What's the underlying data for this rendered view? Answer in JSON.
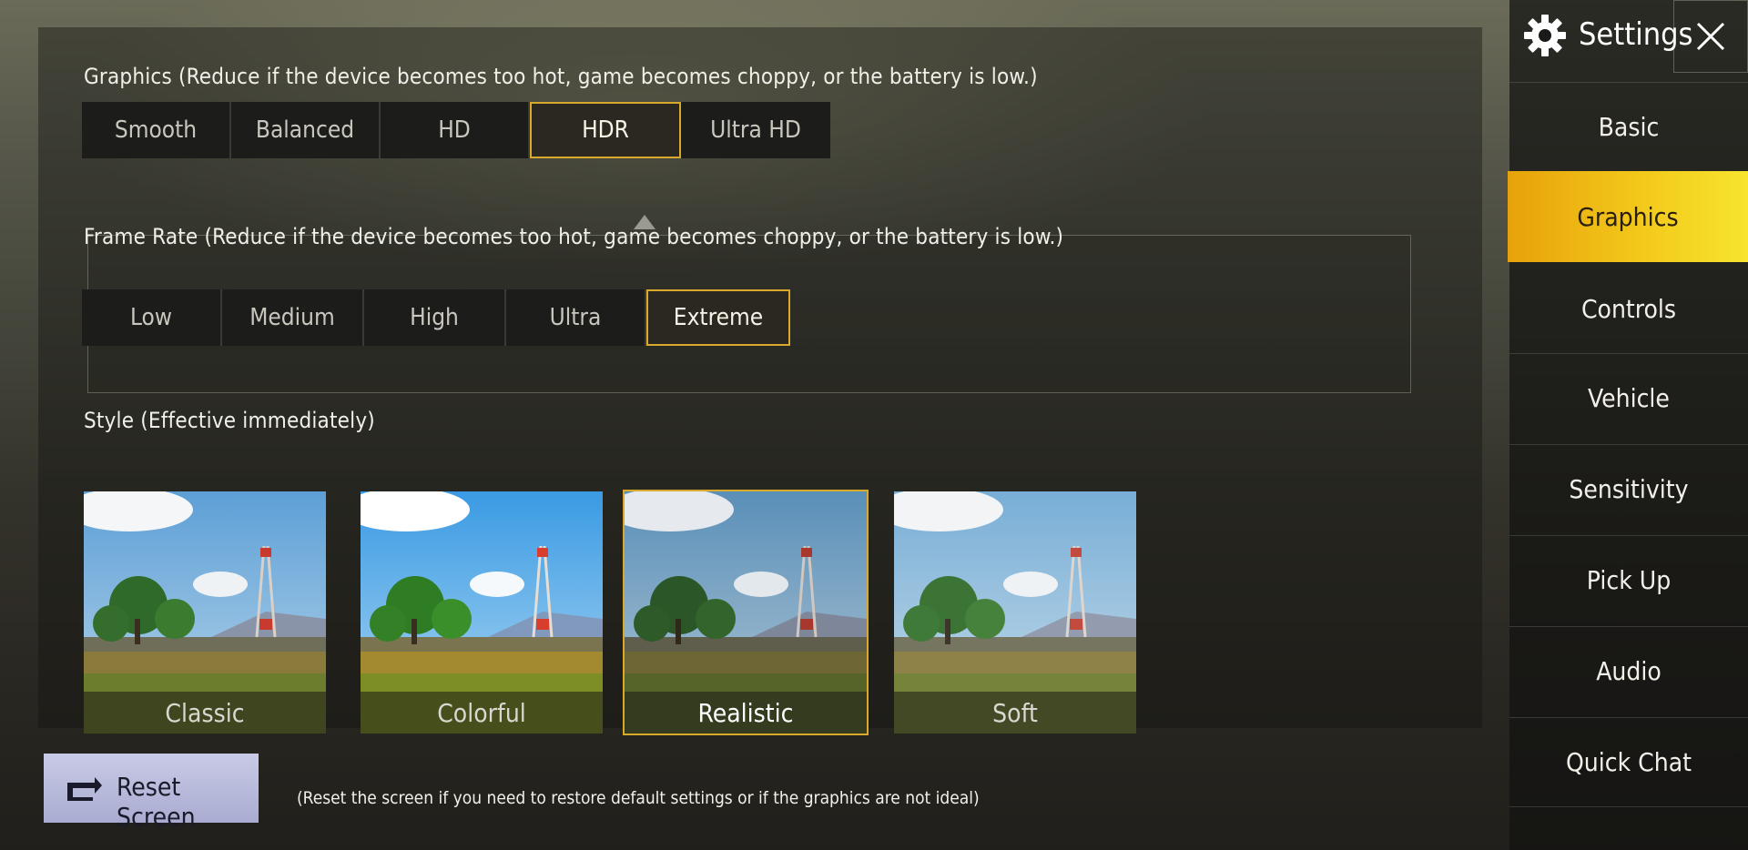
{
  "graphics": {
    "label": "Graphics (Reduce if the device becomes too hot, game becomes choppy, or the battery is low.)",
    "options": [
      "Smooth",
      "Balanced",
      "HD",
      "HDR",
      "Ultra HD"
    ],
    "selected": "HDR"
  },
  "frame_rate": {
    "label": "Frame Rate (Reduce if the device becomes too hot, game becomes choppy, or the battery is low.)",
    "options": [
      "Low",
      "Medium",
      "High",
      "Ultra",
      "Extreme"
    ],
    "selected": "Extreme"
  },
  "style": {
    "label": "Style (Effective immediately)",
    "options": [
      "Classic",
      "Colorful",
      "Realistic",
      "Soft"
    ],
    "selected": "Realistic"
  },
  "sidebar": {
    "title": "Settings",
    "items": [
      "Basic",
      "Graphics",
      "Controls",
      "Vehicle",
      "Sensitivity",
      "Pick Up",
      "Audio",
      "Quick Chat"
    ],
    "active": "Graphics",
    "gear_icon": "gear-icon",
    "close_icon": "close-icon"
  },
  "reset": {
    "label": "Reset Screen",
    "note": "(Reset the screen if you need to restore default settings or if the graphics are not ideal)",
    "icon": "reset-screen-icon"
  },
  "colors": {
    "accent": "#d9a92b",
    "active_tab": "#f3c81a",
    "reset_button": "#b9bbdc"
  }
}
